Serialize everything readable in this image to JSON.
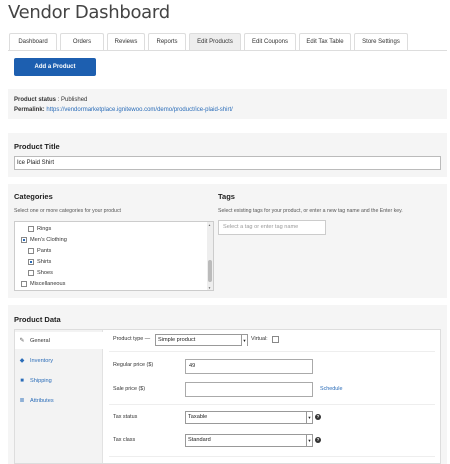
{
  "page": {
    "title": "Vendor Dashboard"
  },
  "tabs": [
    {
      "label": "Dashboard",
      "active": false
    },
    {
      "label": "Orders",
      "active": false
    },
    {
      "label": "Reviews",
      "active": false
    },
    {
      "label": "Reports",
      "active": false
    },
    {
      "label": "Edit Products",
      "active": true
    },
    {
      "label": "Edit Coupons",
      "active": false
    },
    {
      "label": "Edit Tax Table",
      "active": false
    },
    {
      "label": "Store Settings",
      "active": false
    }
  ],
  "add_product_label": "Add a Product",
  "status": {
    "status_label": "Product status",
    "status_value": ": Published",
    "permalink_label": "Permalink:",
    "permalink_url": "https://vendormarketplace.ignitewoo.com/demo/product/ice-plaid-shirt/"
  },
  "product_title": {
    "heading": "Product Title",
    "value": "Ice Plaid Shirt"
  },
  "categories": {
    "heading": "Categories",
    "note": "Select one or more categories for your product",
    "items": [
      {
        "label": "Rings",
        "checked": false
      },
      {
        "label": "Men's Clothing",
        "checked": true
      },
      {
        "label": "Pants",
        "checked": false
      },
      {
        "label": "Shirts",
        "checked": true
      },
      {
        "label": "Shoes",
        "checked": false
      },
      {
        "label": "Miscellaneous",
        "checked": false
      }
    ]
  },
  "tags": {
    "heading": "Tags",
    "note": "Select existing tags for your product, or enter a new tag name and the Enter key.",
    "placeholder": "Select a tag or enter tag name"
  },
  "product_data": {
    "heading": "Product Data",
    "nav": [
      {
        "label": "General",
        "icon": "wrench-icon",
        "active": true
      },
      {
        "label": "Inventory",
        "icon": "diamond-icon",
        "active": false
      },
      {
        "label": "Shipping",
        "icon": "truck-icon",
        "active": false
      },
      {
        "label": "Attributes",
        "icon": "list-icon",
        "active": false
      }
    ],
    "product_type_label": "Product type —",
    "product_type_value": "Simple product",
    "virtual_label": "Virtual:",
    "regular_price_label": "Regular price ($)",
    "regular_price_value": "49",
    "sale_price_label": "Sale price ($)",
    "sale_price_value": "",
    "schedule_label": "Schedule",
    "tax_status_label": "Tax status",
    "tax_status_value": "Taxable",
    "tax_class_label": "Tax class",
    "tax_class_value": "Standard"
  }
}
